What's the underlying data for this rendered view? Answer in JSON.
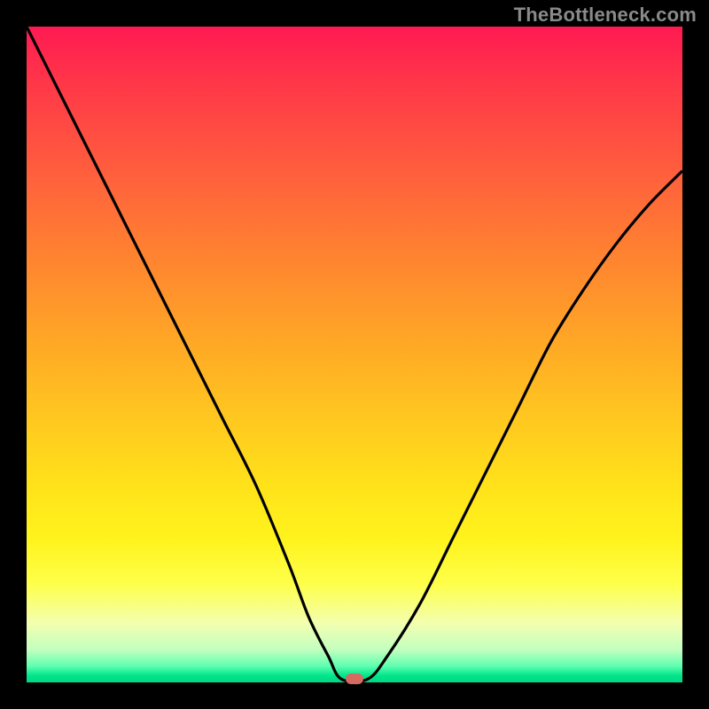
{
  "attribution": "TheBottleneck.com",
  "chart_data": {
    "type": "line",
    "title": "",
    "xlabel": "",
    "ylabel": "",
    "xlim": [
      0,
      100
    ],
    "ylim": [
      0,
      100
    ],
    "series": [
      {
        "name": "bottleneck-curve",
        "x": [
          0,
          5,
          10,
          15,
          20,
          25,
          30,
          35,
          40,
          43,
          46,
          48,
          52,
          55,
          60,
          65,
          70,
          75,
          80,
          85,
          90,
          95,
          100
        ],
        "values": [
          100,
          90,
          80,
          70,
          60,
          50,
          40,
          30,
          18,
          10,
          4,
          0.5,
          0.5,
          4,
          12,
          22,
          32,
          42,
          52,
          60,
          67,
          73,
          78
        ]
      }
    ],
    "annotations": [
      {
        "name": "optimal-marker",
        "x": 50,
        "y": 0.5,
        "color": "#d46a62"
      }
    ],
    "background_gradient": {
      "top": "#ff1a52",
      "mid": "#ffe21a",
      "bottom": "#00d884"
    }
  }
}
